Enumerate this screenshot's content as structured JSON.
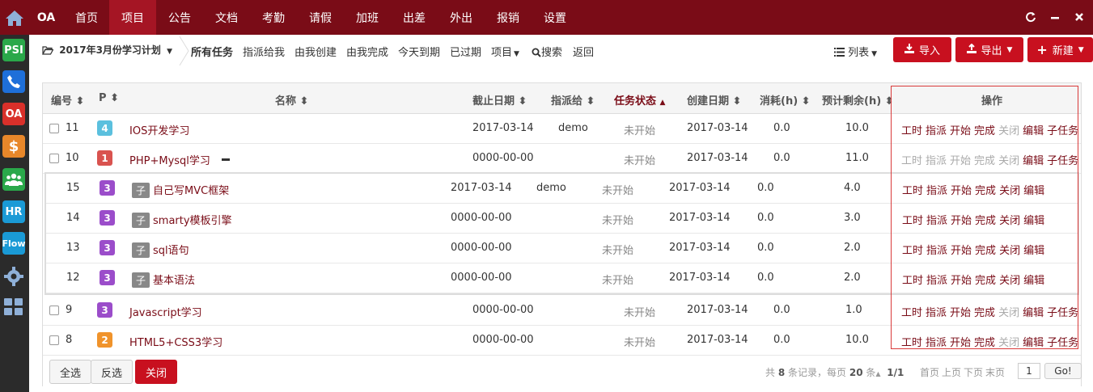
{
  "topnav": {
    "brand": "OA",
    "items": [
      "首页",
      "项目",
      "公告",
      "文档",
      "考勤",
      "请假",
      "加班",
      "出差",
      "外出",
      "报销",
      "设置"
    ],
    "active_index": 1
  },
  "leftbar": {
    "apps": [
      {
        "label": "PSI",
        "color": "#2aa84a"
      },
      {
        "label": "",
        "icon": "phone-icon",
        "color": "#1e6fd9"
      },
      {
        "label": "OA",
        "color": "#d9302a"
      },
      {
        "label": "$",
        "color": "#e8872a"
      },
      {
        "label": "",
        "icon": "team-icon",
        "color": "#2aa84a"
      },
      {
        "label": "HR",
        "color": "#1a9ad6"
      },
      {
        "label": "Flow",
        "color": "#1a9ad6"
      }
    ]
  },
  "subbar": {
    "project_name": "2017年3月份学习计划",
    "filters": [
      "所有任务",
      "指派给我",
      "由我创建",
      "由我完成",
      "今天到期",
      "已过期",
      "项目",
      "搜索",
      "返回"
    ],
    "active_filter": 0,
    "list_toggle": "列表",
    "import_label": "导入",
    "export_label": "导出",
    "new_label": "新建"
  },
  "table": {
    "headers": {
      "id": "编号",
      "pri": "P",
      "name": "名称",
      "deadline": "截止日期",
      "assignee": "指派给",
      "status": "任务状态",
      "created": "创建日期",
      "consumed": "消耗(h)",
      "left": "预计剩余(h)",
      "ops": "操作"
    },
    "sub_badge": "子",
    "rows": [
      {
        "id": "11",
        "pri": "4",
        "pri_color": "#5bc0de",
        "name": "IOS开发学习",
        "deadline": "2017-03-14",
        "assignee": "demo",
        "status": "未开始",
        "created": "2017-03-14",
        "consumed": "0.0",
        "left": "10.0"
      },
      {
        "id": "10",
        "pri": "1",
        "pri_color": "#d9534f",
        "name": "PHP+Mysql学习",
        "deadline": "0000-00-00",
        "assignee": "",
        "status": "未开始",
        "created": "2017-03-14",
        "consumed": "0.0",
        "left": "11.0"
      },
      {
        "id": "9",
        "pri": "3",
        "pri_color": "#9b4dca",
        "name": "Javascript学习",
        "deadline": "0000-00-00",
        "assignee": "",
        "status": "未开始",
        "created": "2017-03-14",
        "consumed": "0.0",
        "left": "1.0"
      },
      {
        "id": "8",
        "pri": "2",
        "pri_color": "#f0932b",
        "name": "HTML5+CSS3学习",
        "deadline": "0000-00-00",
        "assignee": "",
        "status": "未开始",
        "created": "2017-03-14",
        "consumed": "0.0",
        "left": "10.0"
      }
    ],
    "child_rows": [
      {
        "id": "15",
        "pri": "3",
        "pri_color": "#9b4dca",
        "name": "自己写MVC框架",
        "deadline": "2017-03-14",
        "assignee": "demo",
        "status": "未开始",
        "created": "2017-03-14",
        "consumed": "0.0",
        "left": "4.0"
      },
      {
        "id": "14",
        "pri": "3",
        "pri_color": "#9b4dca",
        "name": "smarty模板引擎",
        "deadline": "0000-00-00",
        "assignee": "",
        "status": "未开始",
        "created": "2017-03-14",
        "consumed": "0.0",
        "left": "3.0"
      },
      {
        "id": "13",
        "pri": "3",
        "pri_color": "#9b4dca",
        "name": "sql语句",
        "deadline": "0000-00-00",
        "assignee": "",
        "status": "未开始",
        "created": "2017-03-14",
        "consumed": "0.0",
        "left": "2.0"
      },
      {
        "id": "12",
        "pri": "3",
        "pri_color": "#9b4dca",
        "name": "基本语法",
        "deadline": "0000-00-00",
        "assignee": "",
        "status": "未开始",
        "created": "2017-03-14",
        "consumed": "0.0",
        "left": "2.0"
      }
    ],
    "ops_parent": [
      "工时",
      "指派",
      "开始",
      "完成",
      "关闭",
      "编辑",
      "子任务"
    ],
    "ops_child": [
      "工时",
      "指派",
      "开始",
      "完成",
      "关闭",
      "编辑"
    ]
  },
  "footer": {
    "select_all": "全选",
    "invert": "反选",
    "close": "关闭",
    "record_prefix": "共",
    "record_count": "8",
    "record_suffix": "条记录，每页",
    "per_page": "20",
    "per_page_suffix": "条",
    "page_info": "1/1",
    "first": "首页",
    "prev": "上页",
    "next": "下页",
    "last": "末页",
    "page_value": "1",
    "go": "Go!"
  },
  "colors": {
    "brand": "#7a0c17",
    "brand_active": "#a51524",
    "button_red": "#c8101f"
  }
}
